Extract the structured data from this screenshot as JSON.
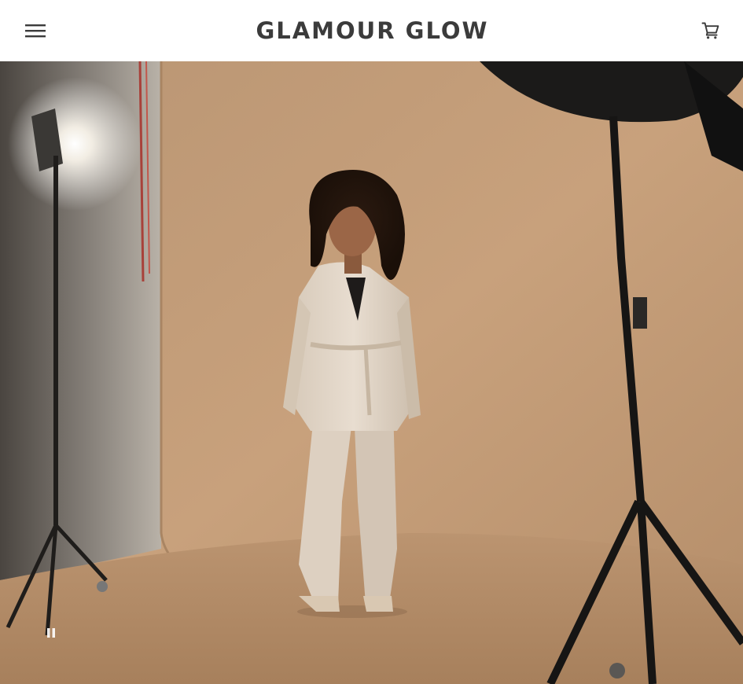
{
  "header": {
    "brand": "GLAMOUR GLOW",
    "menu_icon": "hamburger-menu-icon",
    "cart_icon": "shopping-cart-icon",
    "text_color": "#3b3b3b",
    "background": "#ffffff"
  },
  "hero": {
    "media": "video",
    "playback_control_icon": "pause-icon",
    "backdrop_color": "#c29c78"
  }
}
